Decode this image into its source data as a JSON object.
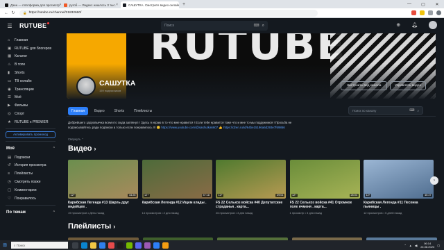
{
  "browser": {
    "tabs": [
      {
        "title": "Дзен — платформа для просмотр",
        "color": "#111111",
        "active": false
      },
      {
        "title": "ругоб — Яндекс нашлось 3 тыс.",
        "color": "#f05a28",
        "active": false
      },
      {
        "title": "САШУТКА. Смотрите видео онлайн",
        "color": "#1a1d23",
        "active": true
      }
    ],
    "url": "https://rutube.ru/channel/31832660/"
  },
  "header": {
    "logo": "RUTUBE",
    "search_placeholder": "Поиск"
  },
  "sidebar": {
    "items": [
      {
        "label": "Главная",
        "icon": "home-icon",
        "glyph": "⌂"
      },
      {
        "label": "RUTUBE для блогеров",
        "icon": "rutube-icon",
        "glyph": "▣"
      },
      {
        "label": "Каталог",
        "icon": "catalog-icon",
        "glyph": "▦"
      },
      {
        "label": "В топе",
        "icon": "fire-icon",
        "glyph": "♨"
      },
      {
        "label": "Shorts",
        "icon": "shorts-icon",
        "glyph": "▮"
      },
      {
        "label": "ТВ онлайн",
        "icon": "tv-icon",
        "glyph": "▭"
      },
      {
        "label": "Трансляции",
        "icon": "broadcast-icon",
        "glyph": "◉"
      },
      {
        "label": "Моё",
        "icon": "my-icon",
        "glyph": "☰"
      },
      {
        "label": "Фильмы",
        "icon": "film-icon",
        "glyph": "▶"
      },
      {
        "label": "Спорт",
        "icon": "sport-icon",
        "glyph": "◎"
      },
      {
        "label": "RUTUBE x PREMIER",
        "icon": "premier-icon",
        "glyph": "★"
      }
    ],
    "promo_button": "Активировать промокод",
    "my_section": {
      "title": "Моё",
      "items": [
        {
          "label": "Подписки",
          "icon": "subscriptions-icon",
          "glyph": "▤"
        },
        {
          "label": "История просмотра",
          "icon": "history-icon",
          "glyph": "↺"
        },
        {
          "label": "Плейлисты",
          "icon": "playlist-icon",
          "glyph": "≡"
        },
        {
          "label": "Смотреть позже",
          "icon": "clock-icon",
          "glyph": "◷"
        },
        {
          "label": "Комментарии",
          "icon": "comment-icon",
          "glyph": "▢"
        },
        {
          "label": "Понравилось",
          "icon": "like-icon",
          "glyph": "♡"
        }
      ]
    },
    "topics_title": "По темам"
  },
  "channel": {
    "name": "САШУТКА",
    "subscribers": "159 подписчиков",
    "customize_button": "Настроить вид канала",
    "manage_button": "Управлять видео",
    "tabs": [
      "Главная",
      "Видео",
      "Shorts",
      "Плейлисты"
    ],
    "search_placeholder": "Поиск по каналу",
    "description_text": "Добрейшего здоровьечка всем кто сюда заглянул ! Здесь я играю в то что мне нравится ! Если тебе нравится тоже что и мне то мы подружимся ! Просьба не подписывайтесь ради подписки а только если понравилось !!! 😊",
    "description_link1": "https://www.youtube.com/@sashutka6607",
    "description_link2": "https://dzen.ru/id/64be15196a6d293e7f69866",
    "collapse_label": "Свернуть"
  },
  "sections": {
    "videos_title": "Видео",
    "playlists_title": "Плейлисты"
  },
  "videos": [
    {
      "title": "Карибская Легенда #13 Шарль друг индейцев .",
      "views": "19 просмотров",
      "age": "День назад",
      "duration": "44:26",
      "rating": "12+",
      "thumb_a": "#6b8e4e",
      "thumb_b": "#a88a5c"
    },
    {
      "title": "Карибская Легенда #12 Ищем клады .",
      "views": "14 просмотров",
      "age": "2 дня назад",
      "duration": "57:18",
      "rating": "12+",
      "thumb_a": "#4d6b3a",
      "thumb_b": "#8a6b46"
    },
    {
      "title": "FS 22 Сельхоз войска #40 Депутатские страданья . карта...",
      "views": "26 просмотров",
      "age": "3 дня назад",
      "duration": "29:01",
      "rating": "12+",
      "thumb_a": "#4f7a2f",
      "thumb_b": "#b79a52"
    },
    {
      "title": "FS 22 Сельхоз войска #41 Огромное поле ячменя . карта...",
      "views": "1 просмотр",
      "age": "3 дня назад",
      "duration": "26:04",
      "rating": "12+",
      "thumb_a": "#6a8d3a",
      "thumb_b": "#a7b356"
    },
    {
      "title": "Карибская Легенда #11 Песенка пьяницы .",
      "views": "12 просмотров",
      "age": "5 дней назад",
      "duration": "45:37",
      "rating": "12+",
      "thumb_a": "#9bb6d4",
      "thumb_b": "#4f6d8f"
    }
  ],
  "taskbar": {
    "search_placeholder": "Поиск",
    "time": "06:14",
    "date": "24.08.2023"
  }
}
